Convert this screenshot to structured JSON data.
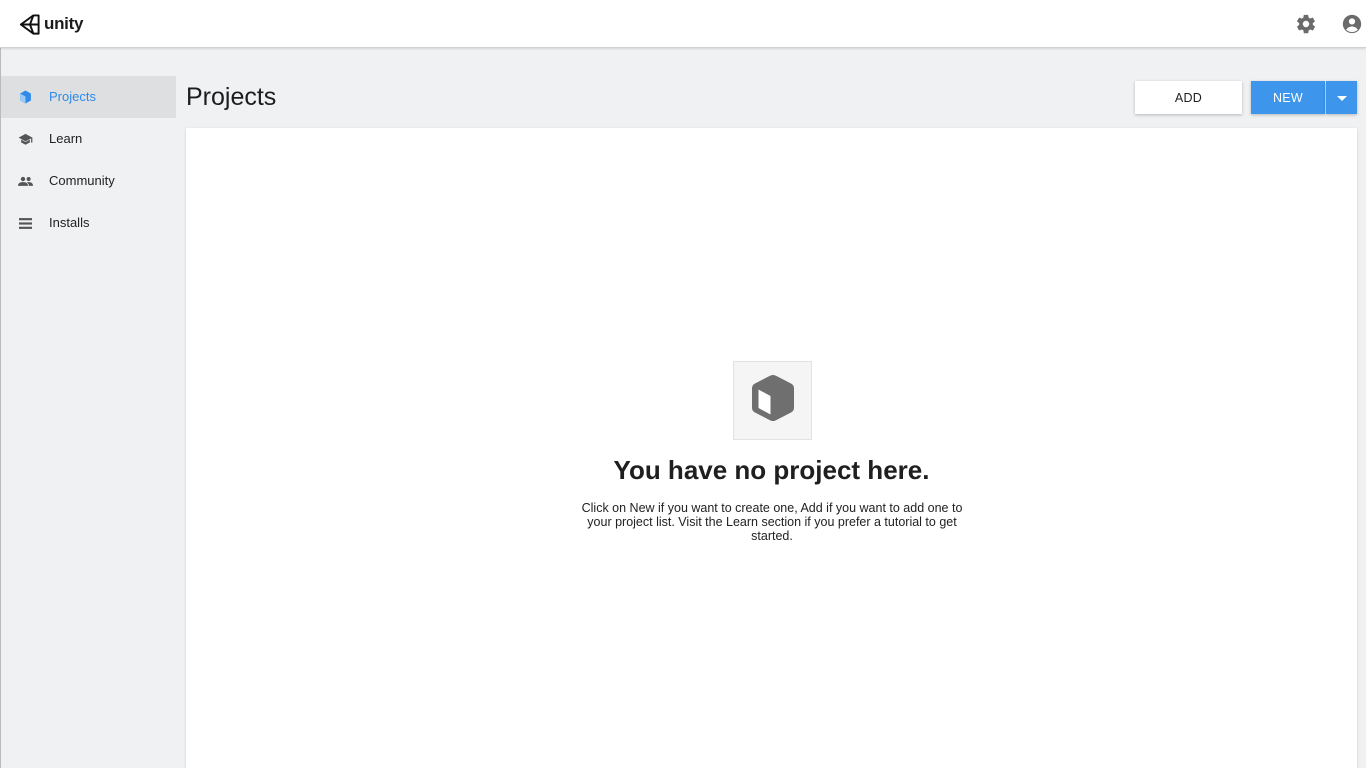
{
  "header": {
    "logo_text": "unity",
    "logo_icon": "unity-logo-icon",
    "settings_icon": "gear-icon",
    "account_icon": "account-circle-icon"
  },
  "sidebar": {
    "items": [
      {
        "label": "Projects",
        "icon": "cube-icon",
        "active": true
      },
      {
        "label": "Learn",
        "icon": "graduation-cap-icon",
        "active": false
      },
      {
        "label": "Community",
        "icon": "people-icon",
        "active": false
      },
      {
        "label": "Installs",
        "icon": "list-icon",
        "active": false
      }
    ]
  },
  "main": {
    "title": "Projects",
    "add_label": "ADD",
    "new_label": "NEW",
    "empty_state": {
      "icon": "cube-icon",
      "title": "You have no project here.",
      "description": "Click on New if you want to create one, Add if you want to add one to your project list. Visit the Learn section if you prefer a tutorial to get started."
    }
  },
  "colors": {
    "accent": "#3d95ec",
    "active_text": "#2f8ae8",
    "background": "#f0f1f3",
    "active_item_bg": "#dedfe1"
  }
}
